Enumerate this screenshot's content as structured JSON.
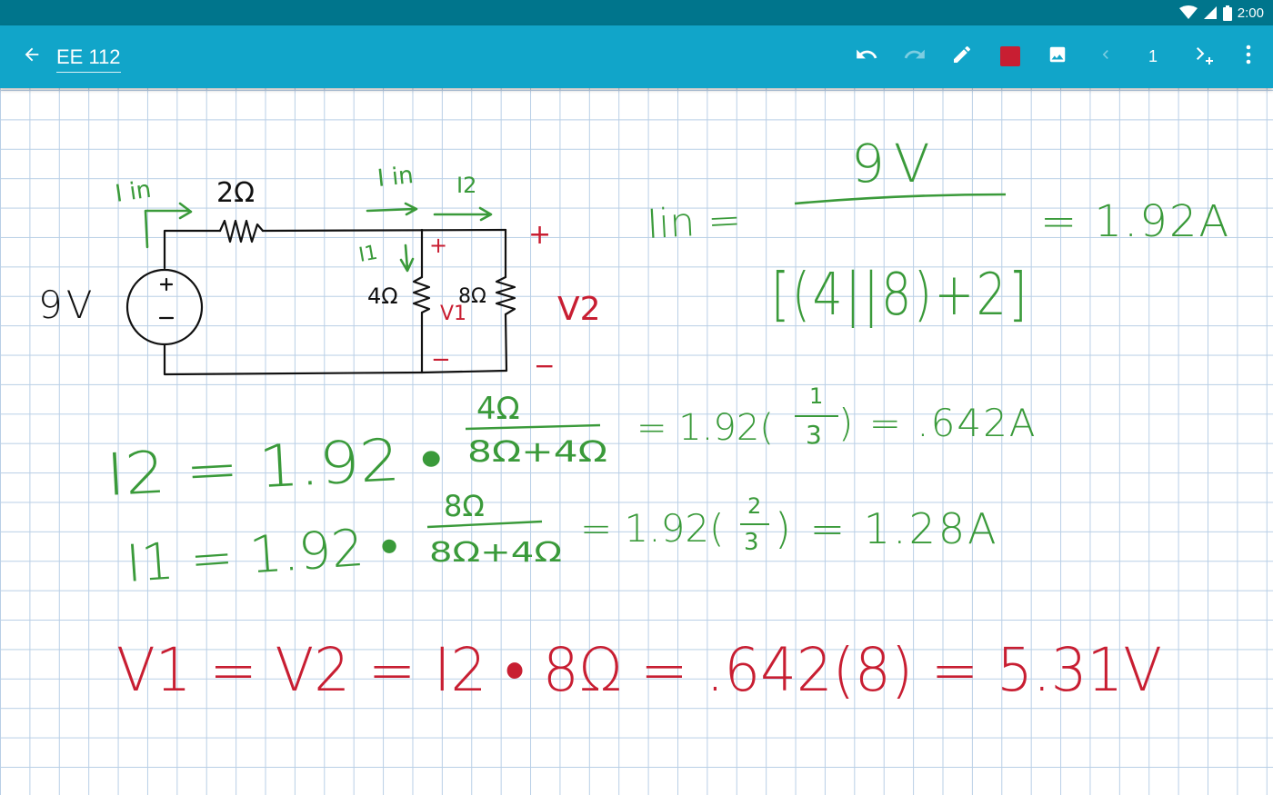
{
  "status_bar": {
    "time": "2:00"
  },
  "toolbar": {
    "title": "EE 112",
    "page_number": "1",
    "pen_color": "#c81e32",
    "icons": {
      "back": "arrow-back-icon",
      "undo": "undo-icon",
      "redo": "redo-icon",
      "pen": "pencil-icon",
      "color": "color-swatch",
      "image": "image-icon",
      "prev_page": "chevron-left-icon",
      "add_page": "add-page-icon",
      "menu": "more-vert-icon"
    }
  },
  "notes": {
    "ink_green": "#3a9a3a",
    "ink_red": "#c81e32",
    "circuit": {
      "source_voltage": "9V",
      "source_plus": "+",
      "source_minus": "−",
      "resistor_series": "2Ω",
      "resistor_4": "4Ω",
      "resistor_8": "8Ω",
      "current_in_left": "I in",
      "current_in_top": "I in",
      "current_i2": "I2",
      "current_i1": "I1",
      "v1_label": "V1",
      "v1_plus": "+",
      "v1_minus": "−",
      "v2_label": "V2",
      "v2_plus": "+",
      "v2_minus": "−"
    },
    "equation_iin": {
      "lhs": "Iin =",
      "numerator": "9V",
      "denominator": "[(4||8)+2]",
      "result": "= 1.92A"
    },
    "equation_i2": {
      "lhs": "I2 = 1.92 •",
      "frac_num": "4Ω",
      "frac_den": "8Ω+4Ω",
      "middle": "= 1.92(",
      "inner_num": "1",
      "inner_den": "3",
      "result": ") = .642A"
    },
    "equation_i1": {
      "lhs": "I1 = 1.92 •",
      "frac_num": "8Ω",
      "frac_den": "8Ω+4Ω",
      "middle": "= 1.92(",
      "inner_num": "2",
      "inner_den": "3",
      "result": ") = 1.28A"
    },
    "equation_v": {
      "text": "V1 = V2 = I2 • 8Ω = .642(8) = 5.31V"
    }
  }
}
